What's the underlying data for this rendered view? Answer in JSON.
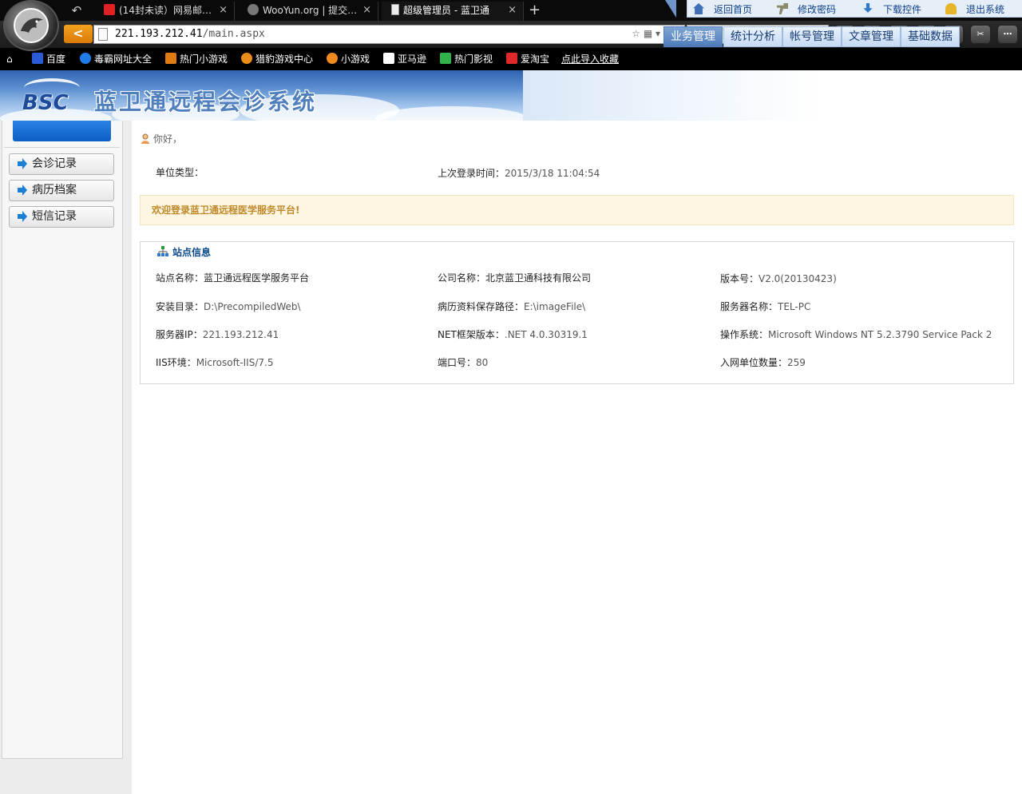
{
  "browser": {
    "tabs": [
      {
        "title": "(14封未读）网易邮…",
        "close": "×"
      },
      {
        "title": "WooYun.org | 提交…",
        "close": "×"
      },
      {
        "title": "超级管理员 - 蓝卫通",
        "close": "×",
        "active": true
      }
    ],
    "new_tab": "+",
    "back_symbol": "↶",
    "nav_back": "<",
    "url_host": "221.193.212.41",
    "url_path": "/main.aspx",
    "url_tools": "☆ ▦ ▾",
    "stop": "✕",
    "search_dropdown": "▾",
    "search_icon": "⚲",
    "toolbar_buttons": [
      "K",
      "■",
      "★",
      "⬇",
      "◉",
      "✂",
      "⋯"
    ],
    "window_controls": [
      "⛉",
      "—",
      "❐",
      "✕"
    ]
  },
  "bookmarks": [
    {
      "label": "百度",
      "icon": "baidu-paw-icon",
      "color": "#2a5bd7"
    },
    {
      "label": "毒霸网址大全",
      "icon": "k-icon",
      "color": "#1f7de8"
    },
    {
      "label": "热门小游戏",
      "icon": "game-icon",
      "color": "#e07a12"
    },
    {
      "label": "猎豹游戏中心",
      "icon": "k-orange-icon",
      "color": "#e88c1a"
    },
    {
      "label": "小游戏",
      "icon": "fox-icon",
      "color": "#f08a1e"
    },
    {
      "label": "亚马逊",
      "icon": "amazon-icon",
      "color": "#ffffff"
    },
    {
      "label": "热门影视",
      "icon": "play-icon",
      "color": "#2fb34a"
    },
    {
      "label": "爱淘宝",
      "icon": "taobao-icon",
      "color": "#e0282a"
    },
    {
      "label": "点此导入收藏",
      "icon": "",
      "color": ""
    }
  ],
  "header": {
    "logo_text": "BSC",
    "system_title": "蓝卫通远程会诊系统",
    "quick_links": [
      "返回首页",
      "修改密码",
      "下载控件",
      "退出系统"
    ],
    "nav_tabs": [
      "业务管理",
      "统计分析",
      "帐号管理",
      "文章管理",
      "基础数据"
    ],
    "active_nav": "业务管理"
  },
  "sidebar": {
    "items": [
      {
        "label": "会诊记录"
      },
      {
        "label": "病历档案"
      },
      {
        "label": "短信记录"
      }
    ]
  },
  "main": {
    "greeting": "你好，",
    "unit_type_label": "单位类型：",
    "unit_type_value": "",
    "last_login_label": "上次登录时间：",
    "last_login_value": "2015/3/18 11:04:54",
    "welcome": "欢迎登录蓝卫通远程医学服务平台!",
    "site_info_title": "站点信息",
    "site_info": [
      {
        "label": "站点名称：",
        "value": "蓝卫通远程医学服务平台"
      },
      {
        "label": "公司名称：",
        "value": "北京蓝卫通科技有限公司"
      },
      {
        "label": "版本号：",
        "value": "V2.0(20130423)"
      },
      {
        "label": "安装目录：",
        "value": "D:\\PrecompiledWeb\\"
      },
      {
        "label": "病历资料保存路径：",
        "value": "E:\\imageFile\\"
      },
      {
        "label": "服务器名称：",
        "value": "TEL-PC"
      },
      {
        "label": "服务器IP：",
        "value": "221.193.212.41"
      },
      {
        "label": "NET框架版本：",
        "value": ".NET 4.0.30319.1"
      },
      {
        "label": "操作系统：",
        "value": "Microsoft Windows NT 5.2.3790 Service Pack 2"
      },
      {
        "label": "IIS环境：",
        "value": "Microsoft-IIS/7.5"
      },
      {
        "label": "端口号：",
        "value": "80"
      },
      {
        "label": "入网单位数量：",
        "value": "259"
      }
    ]
  },
  "colors": {
    "accent_blue": "#0c5fc4",
    "welcome_bg": "#fdf6e2",
    "welcome_text": "#c08a2a",
    "info_title": "#0b4a8a"
  }
}
